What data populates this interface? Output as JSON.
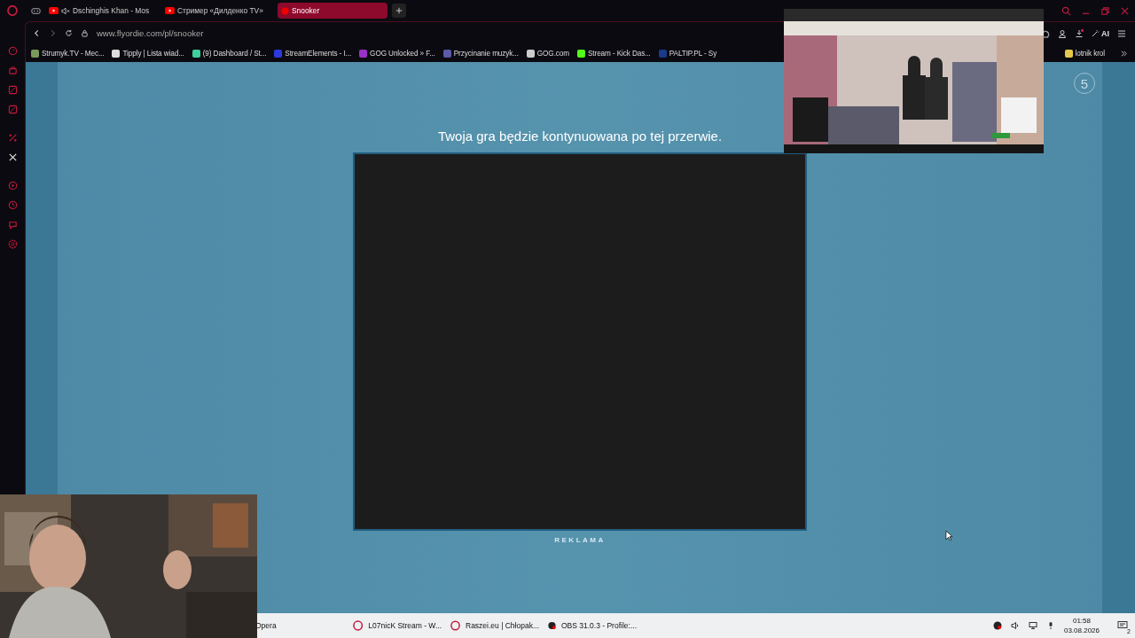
{
  "tabs": [
    {
      "title": "Dschinghis Khan - Mos",
      "selected": false,
      "muted": true
    },
    {
      "title": "Стример «Дилденко TV»",
      "selected": false,
      "muted": false
    },
    {
      "title": "Snooker",
      "selected": true,
      "muted": false
    }
  ],
  "address_bar": {
    "url": "www.flyordie.com/pl/snooker"
  },
  "bookmarks": [
    {
      "label": "Strumyk.TV - Mec...",
      "color": "#7a9a5a"
    },
    {
      "label": "Tipply | Lista wiad...",
      "color": "#dddddd"
    },
    {
      "label": "(9) Dashboard / St...",
      "color": "#3ecf9a"
    },
    {
      "label": "StreamElements - I...",
      "color": "#2a3adc"
    },
    {
      "label": "GOG Unlocked » F...",
      "color": "#9b30c8"
    },
    {
      "label": "Przycinanie muzyk...",
      "color": "#5a5aa8"
    },
    {
      "label": "GOG.com",
      "color": "#cccccc"
    },
    {
      "label": "Stream - Kick Das...",
      "color": "#53fc18"
    },
    {
      "label": "PALTIP.PL - Sy",
      "color": "#1a3a8a"
    },
    {
      "label": "lotnik krol",
      "color": "#e6c84a"
    }
  ],
  "toolbar": {
    "ai_label": "AI"
  },
  "page": {
    "counter": "5",
    "message": "Twoja gra będzie kontynuowana po tej przerwie.",
    "ad_label": "REKLAMA"
  },
  "taskbar": {
    "items": [
      {
        "label": "Opera",
        "kind": "plain"
      },
      {
        "label": "L07nicK Stream - W...",
        "kind": "opera"
      },
      {
        "label": "Raszei.eu | Chłopak...",
        "kind": "opera"
      },
      {
        "label": "OBS 31.0.3 - Profile:...",
        "kind": "obs"
      }
    ],
    "time": "01:58",
    "date": "03.08.2026",
    "notifications": "2"
  }
}
